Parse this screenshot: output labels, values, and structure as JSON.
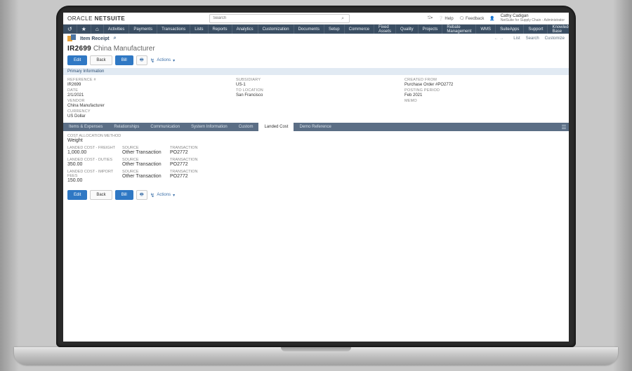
{
  "brand_plain": "ORACLE",
  "brand_bold": "NETSUITE",
  "search": {
    "placeholder": "Search"
  },
  "user": {
    "help": "Help",
    "feedback": "Feedback",
    "name": "Cathy Cadigan",
    "role": "NetSuite for Supply Chain - Administrator"
  },
  "nav": [
    "Activities",
    "Payments",
    "Transactions",
    "Lists",
    "Reports",
    "Analytics",
    "Customization",
    "Documents",
    "Setup",
    "Commerce",
    "Fixed Assets",
    "Quality",
    "Projects",
    "Rebate Management",
    "WMS",
    "SuiteApps",
    "Support",
    "Knowledge Base"
  ],
  "crumb": {
    "icon_tint": "#e8a33a",
    "title": "Item Receipt"
  },
  "rightlinks": [
    "List",
    "Search",
    "Customize"
  ],
  "record": {
    "id": "IR2699",
    "name": "China Manufacturer"
  },
  "buttons": {
    "edit": "Edit",
    "back": "Back",
    "bill": "Bill",
    "actions": "Actions"
  },
  "section_primary": "Primary Information",
  "fields": {
    "col1": [
      {
        "label": "REFERENCE #",
        "value": "IR2699"
      },
      {
        "label": "DATE",
        "value": "2/1/2021"
      },
      {
        "label": "VENDOR",
        "value": "China Manufacturer"
      },
      {
        "label": "CURRENCY",
        "value": "US Dollar"
      }
    ],
    "col2": [
      {
        "label": "SUBSIDIARY",
        "value": "US-1"
      },
      {
        "label": "TO LOCATION",
        "value": "San Francisco"
      }
    ],
    "col3": [
      {
        "label": "CREATED FROM",
        "value": "Purchase Order #PO2772",
        "link": true
      },
      {
        "label": "POSTING PERIOD",
        "value": "Feb 2021"
      },
      {
        "label": "MEMO",
        "value": ""
      }
    ]
  },
  "tabs": [
    "Items & Expenses",
    "Relationships",
    "Communication",
    "System Information",
    "Custom",
    "Landed Cost",
    "Demo Reference"
  ],
  "active_tab": 5,
  "landed_cost": {
    "alloc_label": "COST ALLOCATION METHOD",
    "alloc_value": "Weight",
    "rows": [
      {
        "cat": "LANDED COST - FREIGHT",
        "amount": "1,000.00",
        "source": "Other Transaction",
        "txn": "PO2772"
      },
      {
        "cat": "LANDED COST - DUTIES",
        "amount": "350.00",
        "source": "Other Transaction",
        "txn": "PO2772"
      },
      {
        "cat": "LANDED COST - IMPORT FEES",
        "amount": "150.00",
        "source": "Other Transaction",
        "txn": "PO2772"
      }
    ],
    "col_source": "SOURCE",
    "col_txn": "TRANSACTION"
  }
}
